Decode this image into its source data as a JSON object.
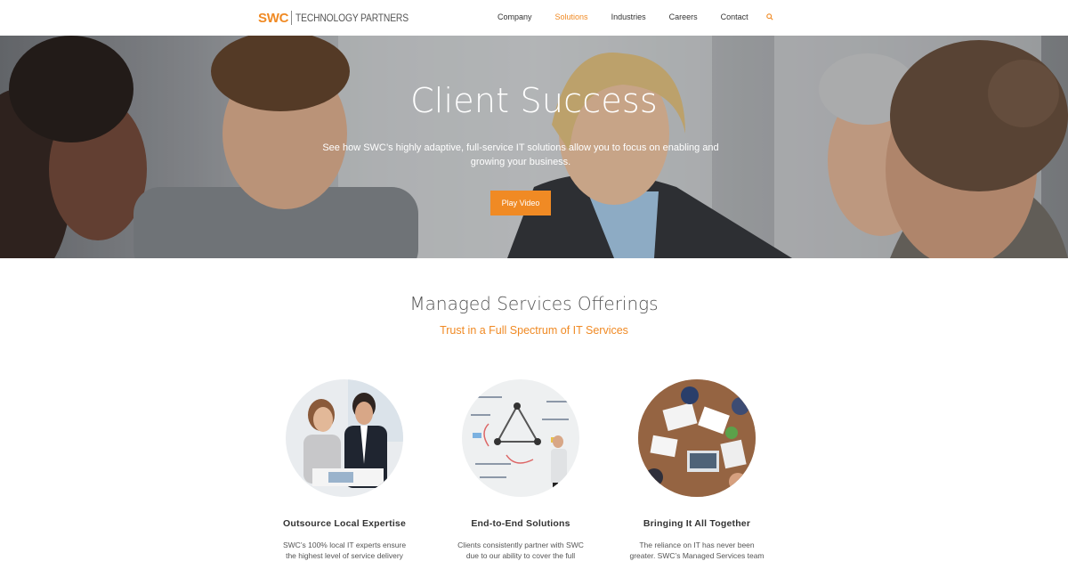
{
  "header": {
    "logo_brand": "SWC",
    "logo_tagline": "TECHNOLOGY PARTNERS",
    "nav": [
      {
        "label": "Company",
        "active": false
      },
      {
        "label": "Solutions",
        "active": true
      },
      {
        "label": "Industries",
        "active": false
      },
      {
        "label": "Careers",
        "active": false
      },
      {
        "label": "Contact",
        "active": false
      }
    ],
    "search_icon": "search-icon"
  },
  "hero": {
    "title": "Client Success",
    "subtitle": "See how SWC’s highly adaptive, full-service IT solutions allow you to focus on enabling and growing your business.",
    "button_label": "Play Video"
  },
  "offerings": {
    "title": "Managed Services Offerings",
    "subtitle": "Trust in a Full Spectrum of IT Services",
    "cards": [
      {
        "title": "Outsource Local Expertise",
        "text": "SWC’s 100% local IT experts ensure the highest level of service delivery through"
      },
      {
        "title": "End-to-End Solutions",
        "text": "Clients consistently partner with SWC due to our ability to cover the full"
      },
      {
        "title": "Bringing It All Together",
        "text": "The reliance on IT has never been greater. SWC’s Managed Services team"
      }
    ]
  },
  "colors": {
    "accent": "#f08a24",
    "text": "#3a3a3a"
  }
}
